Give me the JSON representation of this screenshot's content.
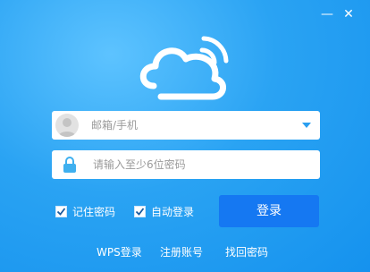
{
  "window": {
    "minimize_glyph": "—",
    "close_glyph": "✕",
    "background_color": "#2aa3f3"
  },
  "logo": {
    "icon": "cloud-wifi-icon"
  },
  "account": {
    "placeholder": "邮箱/手机",
    "avatar_icon": "user-avatar-icon",
    "dropdown_icon": "chevron-down-icon"
  },
  "password": {
    "placeholder": "请输入至少6位密码",
    "icon": "lock-icon"
  },
  "options": {
    "remember_label": "记住密码",
    "remember_checked": true,
    "auto_login_label": "自动登录",
    "auto_login_checked": true
  },
  "login_button": {
    "label": "登录",
    "color": "#1578f2"
  },
  "links": {
    "wps": "WPS登录",
    "register": "注册账号",
    "forgot": "找回密码"
  }
}
